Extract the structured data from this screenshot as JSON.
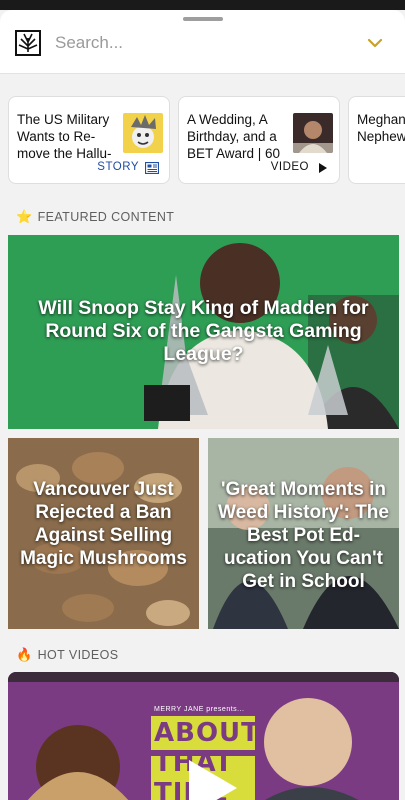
{
  "search": {
    "placeholder": "Search..."
  },
  "top_cards": [
    {
      "title": "The US Military Wants to Re-move the Hallu-",
      "type": "STORY",
      "type_color": "#1f4ea3",
      "type_icon": "newspaper-icon"
    },
    {
      "title": "A Wedding, A Birthday, and a BET Award | 60",
      "type": "VIDEO",
      "type_color": "#111111",
      "type_icon": "play-icon"
    },
    {
      "title": "Meghan Markle's Nephew"
    }
  ],
  "sections": {
    "featured": {
      "icon": "star-icon",
      "label": "FEATURED CONTENT"
    },
    "hot_videos": {
      "icon": "fire-icon",
      "label": "HOT VIDEOS"
    }
  },
  "featured_articles": [
    {
      "title": "Will Snoop Stay King of Madden for Round Six of the Gangsta Gaming League?"
    },
    {
      "title": "Vancouver Just Rejected a Ban Against Selling Magic Mushrooms"
    },
    {
      "title": "'Great Moments in Weed History': The Best Pot Ed-ucation You Can't Get in School"
    }
  ],
  "hot_video": {
    "kicker": "MERRY JANE presents...",
    "title": "ABOUT THAT TIME"
  },
  "colors": {
    "accent": "#c9a227",
    "hero_bg": "#2f9e55",
    "video_bg": "#7a3b83"
  }
}
